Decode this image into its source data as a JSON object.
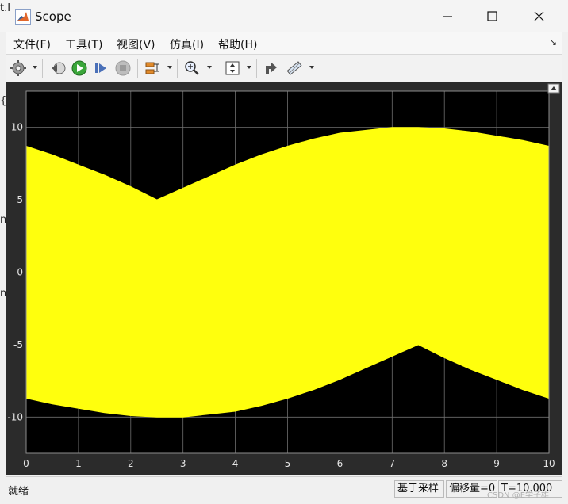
{
  "window": {
    "title": "Scope"
  },
  "background_fragments": [
    "t.I",
    "{(",
    "n",
    "n"
  ],
  "menu": {
    "items": [
      "文件(F)",
      "工具(T)",
      "视图(V)",
      "仿真(I)",
      "帮助(H)"
    ],
    "collapse_arrow": "↘"
  },
  "toolbar": {
    "icons": [
      "gear-icon",
      "step-back-icon",
      "run-icon",
      "step-forward-icon",
      "stop-icon",
      "highlight-icon",
      "zoom-in-icon",
      "autoscale-icon",
      "restore-icon",
      "measure-icon"
    ]
  },
  "status": {
    "text": "就绪",
    "sample_based": "基于采样",
    "offset": "偏移量=0",
    "time": "T=10.000"
  },
  "watermark": "CSDN @E学子雄",
  "colors": {
    "plot_background": "#000000",
    "trace": "#ffff0d",
    "frame": "#2b2b2b",
    "grid": "#6e6e6e",
    "tick_text": "#e6e6e6"
  },
  "chart_data": {
    "type": "area",
    "title": "",
    "xlabel": "",
    "ylabel": "",
    "xlim": [
      0,
      10
    ],
    "ylim": [
      -12.5,
      12.5
    ],
    "xticks": [
      0,
      1,
      2,
      3,
      4,
      5,
      6,
      7,
      8,
      9,
      10
    ],
    "yticks": [
      10,
      5,
      0,
      -5,
      -10
    ],
    "grid": true,
    "series": [
      {
        "upper": {
          "x": [
            0,
            0.5,
            1,
            1.5,
            2,
            2.5,
            3,
            3.5,
            4,
            4.5,
            5,
            5.5,
            6,
            6.5,
            7,
            7.5,
            8,
            8.5,
            9,
            9.5,
            10
          ],
          "y": [
            8.7,
            8.1,
            7.4,
            6.7,
            5.9,
            5.0,
            5.8,
            6.6,
            7.4,
            8.1,
            8.7,
            9.2,
            9.6,
            9.8,
            10.0,
            10.0,
            9.9,
            9.7,
            9.4,
            9.1,
            8.7
          ]
        },
        "lower": {
          "x": [
            0,
            0.5,
            1,
            1.5,
            2,
            2.5,
            3,
            3.5,
            4,
            4.5,
            5,
            5.5,
            6,
            6.5,
            7,
            7.5,
            8,
            8.5,
            9,
            9.5,
            10
          ],
          "y": [
            -8.7,
            -9.1,
            -9.4,
            -9.7,
            -9.9,
            -10.0,
            -10.0,
            -9.8,
            -9.6,
            -9.2,
            -8.7,
            -8.1,
            -7.4,
            -6.6,
            -5.8,
            -5.0,
            -5.9,
            -6.7,
            -7.4,
            -8.1,
            -8.7
          ]
        }
      }
    ]
  }
}
